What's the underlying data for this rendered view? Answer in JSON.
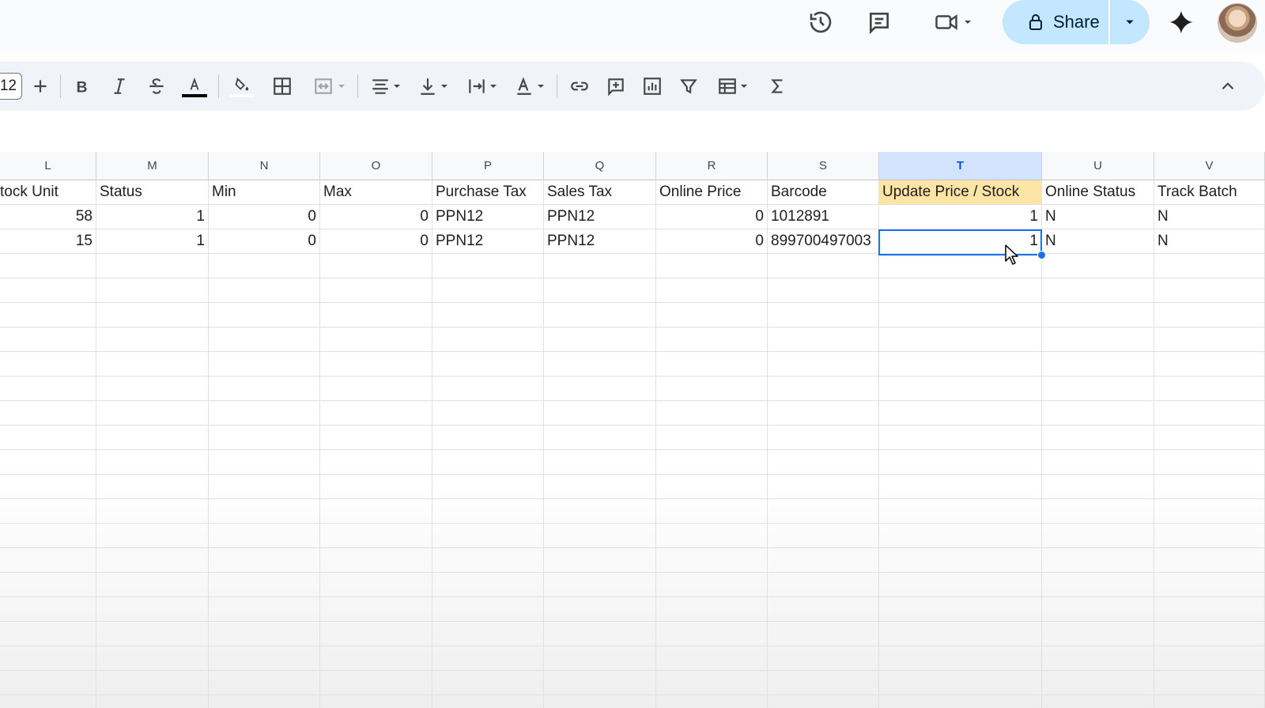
{
  "topbar": {
    "icons": [
      "history-icon",
      "comment-icon",
      "video-call-icon",
      "gemini-icon"
    ],
    "share_label": "Share"
  },
  "toolbar": {
    "font_size": "12",
    "tools": [
      "plus",
      "bold",
      "italic",
      "strikethrough",
      "text-color",
      "fill-color",
      "borders",
      "merge-cells",
      "horizontal-align",
      "vertical-align",
      "text-wrap",
      "text-rotation",
      "insert-link",
      "insert-comment",
      "insert-chart",
      "create-filter",
      "table",
      "functions",
      "collapse"
    ],
    "colors": {
      "text_color_bar": "#000000"
    }
  },
  "sheet": {
    "columns": [
      "L",
      "M",
      "N",
      "O",
      "P",
      "Q",
      "R",
      "S",
      "T",
      "U",
      "V"
    ],
    "selected_column": "T",
    "header_row": [
      "tock Unit",
      "Status",
      "Min",
      "Max",
      "Purchase Tax",
      "Sales Tax",
      "Online Price",
      "Barcode",
      "Update Price / Stock",
      "Online Status",
      "Track Batch"
    ],
    "rows": [
      [
        "58",
        "1",
        "0",
        "0",
        "PPN12",
        "PPN12",
        "0",
        "1012891",
        "1",
        "N",
        "N"
      ],
      [
        "15",
        "1",
        "0",
        "0",
        "PPN12",
        "PPN12",
        "0",
        "899700497003",
        "1",
        "N",
        "N"
      ]
    ],
    "highlight_color": "#fbe4a6",
    "selection_color": "#1a73e8"
  }
}
